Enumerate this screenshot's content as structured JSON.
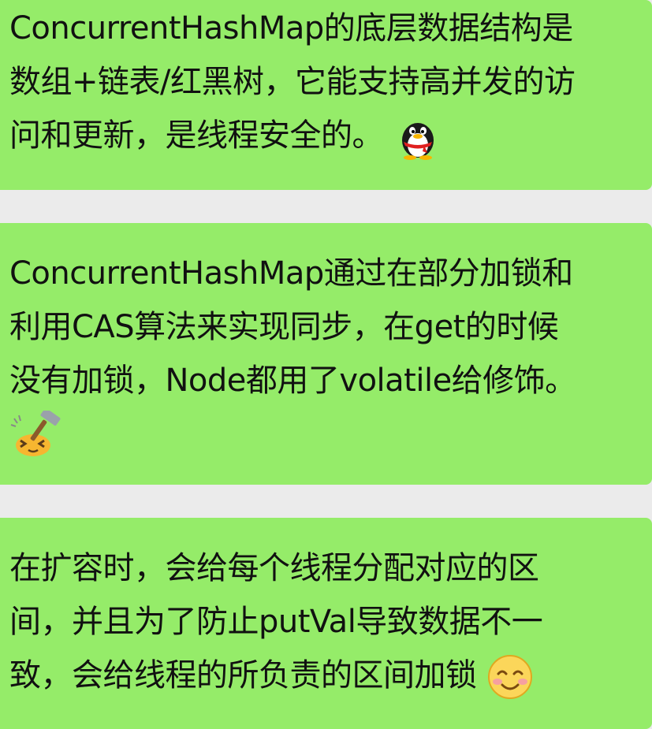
{
  "messages": [
    {
      "lines": [
        "ConcurrentHashMap的底层数据结构是",
        "数组+链表/红黑树，它能支持高并发的访",
        "问和更新，是线程安全的。"
      ],
      "emoji": "penguin-emoji-icon"
    },
    {
      "lines": [
        "ConcurrentHashMap通过在部分加锁和",
        "利用CAS算法来实现同步，在get的时候",
        "没有加锁，Node都用了volatile给修饰。"
      ],
      "emoji": "hammer-head-emoji-icon"
    },
    {
      "lines": [
        "在扩容时，会给每个线程分配对应的区",
        "间，并且为了防止putVal导致数据不一",
        "致，会给线程的所负责的区间加锁"
      ],
      "emoji": "smiling-face-emoji-icon"
    }
  ],
  "colors": {
    "bubble": "#95ec69",
    "background": "#ebebeb",
    "text": "#111111"
  }
}
